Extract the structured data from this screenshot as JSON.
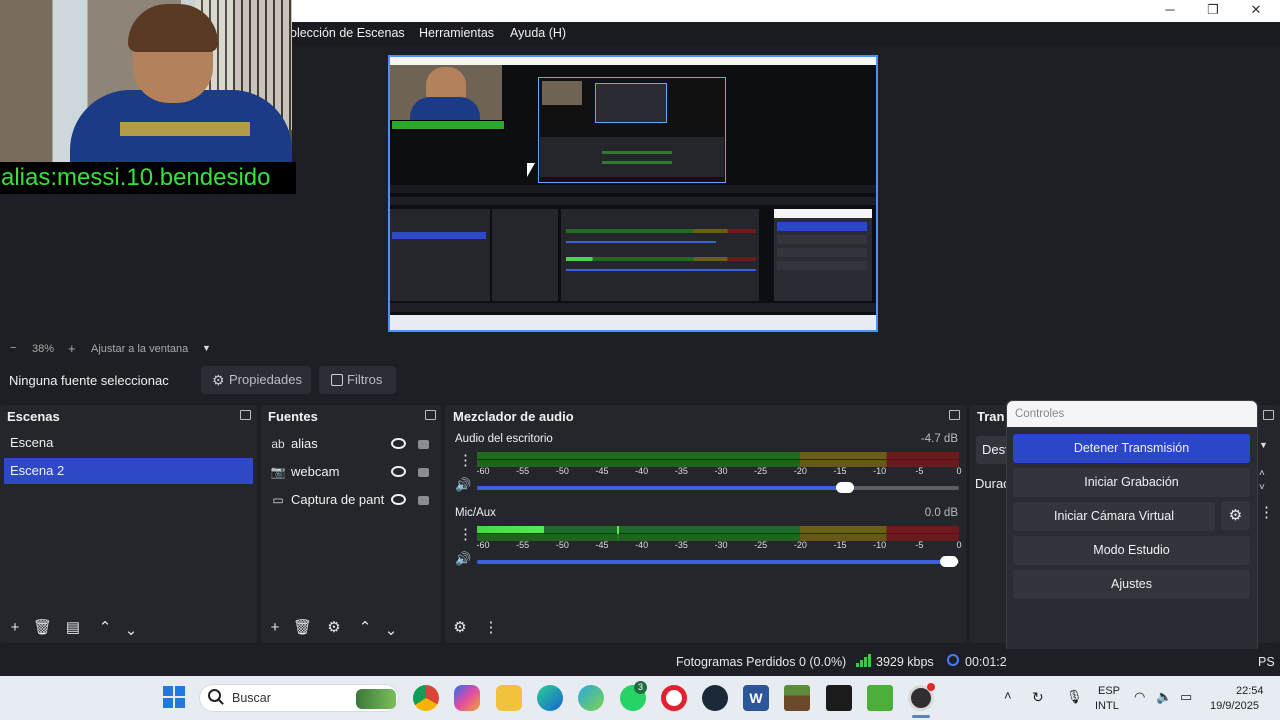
{
  "menu": {
    "items": [
      "olección de Escenas",
      "Herramientas",
      "Ayuda (H)"
    ]
  },
  "window_controls": {
    "minimize": "─",
    "maximize": "❐",
    "close": "✕"
  },
  "webcam": {
    "alias_text": "alias:messi.10.bendesido"
  },
  "zoom": {
    "minus": "−",
    "value": "38%",
    "plus": "+",
    "fit_label": "Ajustar a la ventana",
    "dropdown": "▼"
  },
  "source_bar": {
    "no_source": "Ninguna fuente seleccionac",
    "properties": "Propiedades",
    "filters": "Filtros"
  },
  "scenes": {
    "title": "Escenas",
    "items": [
      {
        "label": "Escena",
        "active": false
      },
      {
        "label": "Escena 2",
        "active": true
      }
    ]
  },
  "sources": {
    "title": "Fuentes",
    "items": [
      {
        "label": "alias",
        "icon": "text-icon"
      },
      {
        "label": "webcam",
        "icon": "camera-icon"
      },
      {
        "label": "Captura de pant",
        "icon": "monitor-icon"
      }
    ]
  },
  "mixer": {
    "title": "Mezclador de audio",
    "ticks": [
      "-60",
      "-55",
      "-50",
      "-45",
      "-40",
      "-35",
      "-30",
      "-25",
      "-20",
      "-15",
      "-10",
      "-5",
      "0"
    ],
    "channels": [
      {
        "name": "Audio del escritorio",
        "db": "-4.7 dB",
        "level": 0.0,
        "volume": 0.78
      },
      {
        "name": "Mic/Aux",
        "db": "0.0 dB",
        "level": 0.14,
        "volume": 1.0
      }
    ]
  },
  "transitions": {
    "title": "Tran",
    "dropdown": "Desv",
    "duration_label": "Durac"
  },
  "controls": {
    "title": "Controles",
    "buttons": [
      "Detener Transmisión",
      "Iniciar Grabación",
      "Iniciar Cámara Virtual",
      "Modo Estudio",
      "Ajustes"
    ]
  },
  "status": {
    "dropped_frames": "Fotogramas Perdidos 0 (0.0%)",
    "bitrate": "3929 kbps",
    "stream_time": "00:01:2",
    "trailing": "PS"
  },
  "taskbar": {
    "search_placeholder": "Buscar",
    "whatsapp_badge": "3",
    "lang_top": "ESP",
    "lang_bottom": "INTL",
    "time": "22:54",
    "date": "19/9/2025"
  },
  "colors": {
    "accent": "#2f48c6",
    "alias_green": "#37e13b",
    "preview_border": "#4a90ff",
    "panel": "#24262c"
  }
}
